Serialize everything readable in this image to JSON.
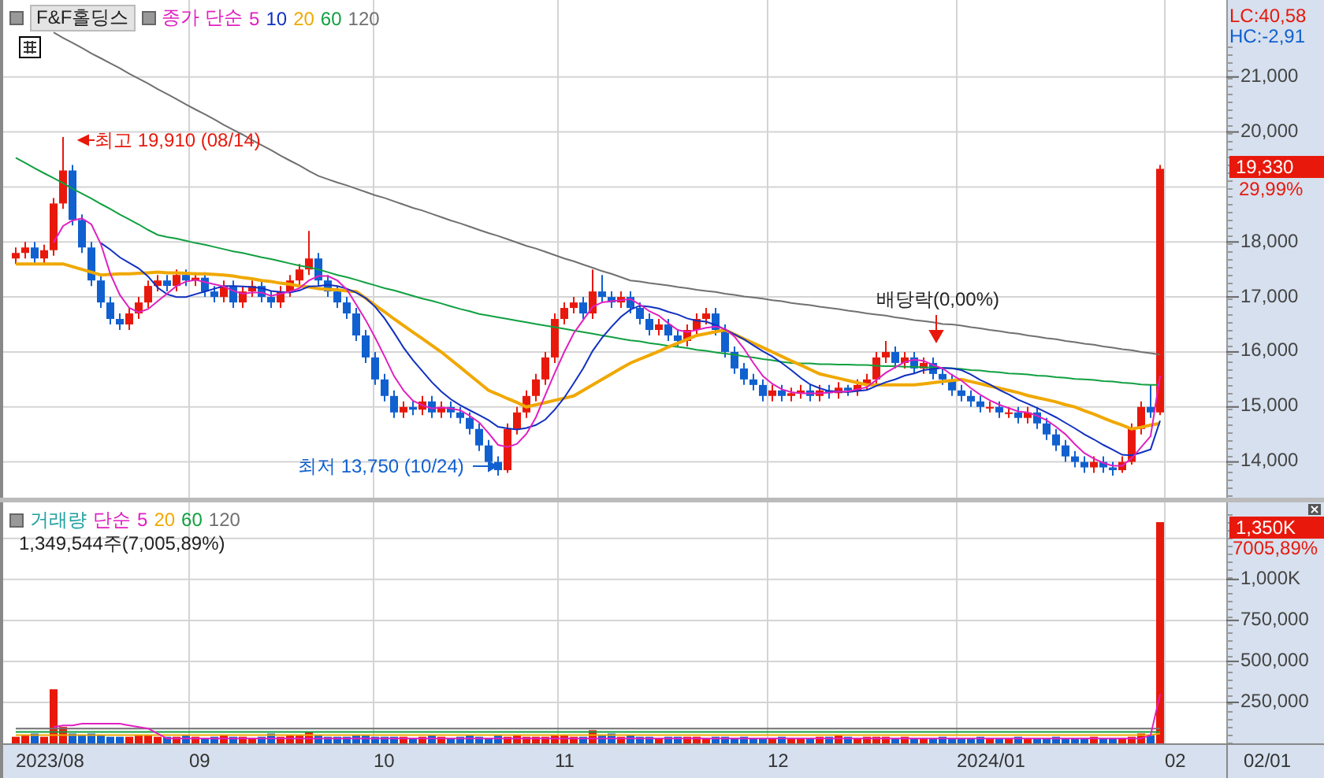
{
  "legend": {
    "ticker": "F&F홀딩스",
    "label": "종가 단순"
  },
  "price_chart": {
    "lc": "LC:40,58",
    "hc": "HC:-2,91",
    "current": "19,330",
    "change": "29,99%",
    "chart_data": {
      "type": "candlestick",
      "ylim": [
        13350,
        22400
      ],
      "grid": true,
      "series": [
        {
          "name": "5",
          "color": "#e020c0",
          "type": "line",
          "values": [
            null,
            null,
            null,
            null,
            17990,
            18290,
            18390,
            18430,
            18320,
            17960,
            17420,
            17040,
            16800,
            16720,
            16780,
            16920,
            17060,
            17200,
            17280,
            17310,
            17270,
            17230,
            17190,
            17110,
            17060,
            17080,
            17080,
            17020,
            17060,
            17100,
            17160,
            17300,
            17380,
            17380,
            17300,
            17140,
            16860,
            16580,
            16260,
            15920,
            15560,
            15300,
            15110,
            15030,
            14970,
            14990,
            14970,
            14940,
            14840,
            14720,
            14520,
            14310,
            14270,
            14330,
            14510,
            14810,
            15220,
            15620,
            16000,
            16340,
            16580,
            16820,
            16900,
            16920,
            16940,
            16960,
            16860,
            16740,
            16660,
            16520,
            16400,
            16360,
            16400,
            16440,
            16460,
            16420,
            16280,
            16060,
            15800,
            15560,
            15420,
            15320,
            15270,
            15250,
            15250,
            15250,
            15260,
            15280,
            15280,
            15320,
            15360,
            15490,
            15620,
            15720,
            15820,
            15860,
            15840,
            15760,
            15700,
            15580,
            15480,
            15340,
            15220,
            15120,
            15040,
            14980,
            14920,
            14900,
            14840,
            14760,
            14640,
            14500,
            14320,
            14160,
            14060,
            13980,
            13930,
            13930,
            14070,
            14270,
            14470,
            15570
          ]
        },
        {
          "name": "10",
          "color": "#1030c0",
          "type": "line",
          "values": [
            null,
            null,
            null,
            null,
            null,
            null,
            null,
            null,
            null,
            17980,
            17860,
            17720,
            17620,
            17520,
            17370,
            17170,
            17050,
            17000,
            17000,
            17050,
            17100,
            17150,
            17200,
            17200,
            17190,
            17180,
            17160,
            17110,
            17090,
            17080,
            17120,
            17190,
            17200,
            17220,
            17200,
            17150,
            17080,
            16980,
            16820,
            16610,
            16350,
            16080,
            15850,
            15650,
            15450,
            15280,
            15140,
            15030,
            14940,
            14850,
            14760,
            14640,
            14610,
            14590,
            14620,
            14670,
            14770,
            14950,
            15170,
            15430,
            15700,
            16020,
            16260,
            16460,
            16640,
            16770,
            16840,
            16820,
            16790,
            16730,
            16680,
            16610,
            16570,
            16550,
            16490,
            16410,
            16320,
            16230,
            16120,
            16010,
            15920,
            15800,
            15670,
            15530,
            15410,
            15340,
            15290,
            15280,
            15270,
            15290,
            15310,
            15380,
            15450,
            15500,
            15570,
            15610,
            15670,
            15690,
            15710,
            15700,
            15670,
            15590,
            15490,
            15410,
            15310,
            15230,
            15130,
            15060,
            14980,
            14900,
            14810,
            14710,
            14610,
            14500,
            14410,
            14310,
            14220,
            14130,
            14120,
            14170,
            14230,
            14750
          ]
        },
        {
          "name": "20",
          "color": "#f0a800",
          "type": "line",
          "values": [
            17600,
            17600,
            17600,
            17600,
            17600,
            17600,
            17550,
            17500,
            17450,
            17400,
            17410,
            17420,
            17420,
            17430,
            17440,
            17450,
            17440,
            17440,
            17430,
            17420,
            17420,
            17410,
            17400,
            17380,
            17350,
            17330,
            17300,
            17280,
            17250,
            17230,
            17200,
            17180,
            17150,
            17140,
            17130,
            17110,
            17100,
            16980,
            16850,
            16730,
            16600,
            16480,
            16360,
            16240,
            16120,
            16000,
            15860,
            15720,
            15580,
            15440,
            15300,
            15230,
            15150,
            15080,
            15000,
            15040,
            15080,
            15120,
            15160,
            15200,
            15300,
            15400,
            15500,
            15600,
            15700,
            15800,
            15870,
            15940,
            16010,
            16090,
            16160,
            16230,
            16300,
            16330,
            16370,
            16400,
            16320,
            16240,
            16160,
            16080,
            16000,
            15920,
            15840,
            15760,
            15680,
            15600,
            15560,
            15520,
            15480,
            15440,
            15400,
            15400,
            15400,
            15400,
            15400,
            15400,
            15420,
            15440,
            15460,
            15480,
            15500,
            15460,
            15420,
            15380,
            15340,
            15300,
            15260,
            15210,
            15170,
            15130,
            15090,
            15040,
            15000,
            14930,
            14870,
            14800,
            14730,
            14670,
            14600,
            14630,
            14670,
            14700
          ]
        },
        {
          "name": "60",
          "color": "#10a040",
          "type": "line",
          "values": [
            19530,
            19440,
            19340,
            19250,
            19160,
            19070,
            18970,
            18880,
            18790,
            18690,
            18600,
            18500,
            18410,
            18320,
            18220,
            18130,
            18090,
            18060,
            18020,
            17980,
            17950,
            17910,
            17870,
            17830,
            17800,
            17760,
            17720,
            17690,
            17650,
            17610,
            17570,
            17540,
            17500,
            17450,
            17400,
            17360,
            17310,
            17260,
            17210,
            17160,
            17120,
            17070,
            17020,
            16970,
            16930,
            16880,
            16830,
            16780,
            16740,
            16690,
            16660,
            16630,
            16600,
            16570,
            16540,
            16510,
            16480,
            16450,
            16420,
            16390,
            16360,
            16330,
            16300,
            16270,
            16240,
            16210,
            16190,
            16160,
            16140,
            16110,
            16090,
            16070,
            16040,
            16020,
            15990,
            15970,
            15950,
            15920,
            15900,
            15870,
            15850,
            15820,
            15800,
            15790,
            15790,
            15780,
            15780,
            15770,
            15770,
            15760,
            15760,
            15750,
            15740,
            15740,
            15730,
            15730,
            15720,
            15720,
            15710,
            15700,
            15690,
            15670,
            15660,
            15640,
            15630,
            15610,
            15600,
            15590,
            15570,
            15560,
            15540,
            15530,
            15510,
            15500,
            15490,
            15470,
            15460,
            15440,
            15430,
            15410,
            15400,
            15400
          ]
        },
        {
          "name": "120",
          "color": "#707070",
          "type": "line",
          "values": [
            null,
            null,
            null,
            null,
            21810,
            21710,
            21620,
            21530,
            21430,
            21340,
            21250,
            21160,
            21060,
            20970,
            20880,
            20780,
            20690,
            20600,
            20500,
            20410,
            20320,
            20230,
            20130,
            20040,
            19950,
            19850,
            19760,
            19670,
            19570,
            19480,
            19390,
            19290,
            19200,
            19140,
            19080,
            19030,
            18970,
            18910,
            18850,
            18800,
            18740,
            18680,
            18620,
            18570,
            18510,
            18450,
            18390,
            18340,
            18280,
            18220,
            18160,
            18110,
            18050,
            17990,
            17930,
            17880,
            17820,
            17760,
            17700,
            17650,
            17590,
            17530,
            17470,
            17420,
            17360,
            17300,
            17280,
            17250,
            17230,
            17210,
            17180,
            17160,
            17130,
            17110,
            17090,
            17060,
            17040,
            17010,
            16990,
            16970,
            16940,
            16920,
            16890,
            16870,
            16850,
            16820,
            16800,
            16780,
            16750,
            16730,
            16700,
            16680,
            16660,
            16630,
            16610,
            16580,
            16560,
            16540,
            16510,
            16500,
            16480,
            16450,
            16430,
            16400,
            16380,
            16350,
            16330,
            16300,
            16280,
            16250,
            16230,
            16200,
            16180,
            16150,
            16130,
            16100,
            16080,
            16050,
            16030,
            16000,
            15980,
            15950
          ]
        }
      ],
      "yticks": [
        {
          "value": 21000,
          "label": "21,000"
        },
        {
          "value": 20000,
          "label": "20,000"
        },
        {
          "value": 18000,
          "label": "18,000"
        },
        {
          "value": 17000,
          "label": "17,000"
        },
        {
          "value": 16000,
          "label": "16,000"
        },
        {
          "value": 15000,
          "label": "15,000"
        },
        {
          "value": 14000,
          "label": "14,000"
        }
      ],
      "ohlc": [
        [
          17700,
          17900,
          17600,
          17800
        ],
        [
          17800,
          18000,
          17700,
          17900
        ],
        [
          17900,
          18000,
          17600,
          17700
        ],
        [
          17700,
          17950,
          17600,
          17850
        ],
        [
          17850,
          18800,
          17750,
          18700
        ],
        [
          18700,
          19910,
          18600,
          19300
        ],
        [
          19300,
          19400,
          18300,
          18400
        ],
        [
          18400,
          18500,
          17800,
          17900
        ],
        [
          17900,
          18000,
          17200,
          17300
        ],
        [
          17300,
          17400,
          16800,
          16900
        ],
        [
          16900,
          17000,
          16500,
          16600
        ],
        [
          16600,
          16700,
          16400,
          16500
        ],
        [
          16500,
          16800,
          16400,
          16700
        ],
        [
          16700,
          17000,
          16600,
          16900
        ],
        [
          16900,
          17300,
          16800,
          17200
        ],
        [
          17200,
          17400,
          17100,
          17300
        ],
        [
          17300,
          17400,
          17100,
          17200
        ],
        [
          17200,
          17500,
          17100,
          17400
        ],
        [
          17400,
          17500,
          17200,
          17300
        ],
        [
          17300,
          17450,
          17200,
          17350
        ],
        [
          17350,
          17450,
          17000,
          17100
        ],
        [
          17100,
          17200,
          16900,
          17000
        ],
        [
          17000,
          17300,
          16900,
          17200
        ],
        [
          17200,
          17300,
          16800,
          16900
        ],
        [
          16900,
          17200,
          16800,
          17100
        ],
        [
          17100,
          17300,
          17000,
          17200
        ],
        [
          17200,
          17300,
          16900,
          17000
        ],
        [
          17000,
          17100,
          16800,
          16900
        ],
        [
          16900,
          17200,
          16800,
          17100
        ],
        [
          17100,
          17400,
          17000,
          17300
        ],
        [
          17300,
          17600,
          17200,
          17500
        ],
        [
          17500,
          18200,
          17400,
          17700
        ],
        [
          17700,
          17800,
          17200,
          17300
        ],
        [
          17300,
          17400,
          17000,
          17100
        ],
        [
          17100,
          17200,
          16800,
          16900
        ],
        [
          16900,
          17000,
          16600,
          16700
        ],
        [
          16700,
          16800,
          16200,
          16300
        ],
        [
          16300,
          16400,
          15800,
          15900
        ],
        [
          15900,
          16000,
          15400,
          15500
        ],
        [
          15500,
          15600,
          15100,
          15200
        ],
        [
          15200,
          15300,
          14800,
          14900
        ],
        [
          14900,
          15100,
          14800,
          15000
        ],
        [
          15000,
          15100,
          14850,
          14950
        ],
        [
          14950,
          15200,
          14850,
          15100
        ],
        [
          15100,
          15200,
          14800,
          14900
        ],
        [
          14900,
          15100,
          14800,
          15000
        ],
        [
          15000,
          15100,
          14800,
          14900
        ],
        [
          14900,
          15000,
          14700,
          14800
        ],
        [
          14800,
          14900,
          14500,
          14600
        ],
        [
          14600,
          14700,
          14200,
          14300
        ],
        [
          14300,
          14400,
          13900,
          14000
        ],
        [
          14000,
          14100,
          13750,
          13850
        ],
        [
          13850,
          14700,
          13800,
          14600
        ],
        [
          14600,
          15000,
          14500,
          14900
        ],
        [
          14900,
          15300,
          14800,
          15200
        ],
        [
          15200,
          15600,
          15100,
          15500
        ],
        [
          15500,
          16000,
          15400,
          15900
        ],
        [
          15900,
          16700,
          15800,
          16600
        ],
        [
          16600,
          16900,
          16500,
          16800
        ],
        [
          16800,
          17000,
          16700,
          16900
        ],
        [
          16900,
          17000,
          16600,
          16700
        ],
        [
          16700,
          17500,
          16600,
          17100
        ],
        [
          17100,
          17400,
          16900,
          17000
        ],
        [
          17000,
          17100,
          16800,
          16900
        ],
        [
          16900,
          17100,
          16800,
          17000
        ],
        [
          17000,
          17100,
          16700,
          16800
        ],
        [
          16800,
          16900,
          16500,
          16600
        ],
        [
          16600,
          16700,
          16300,
          16400
        ],
        [
          16400,
          16600,
          16300,
          16500
        ],
        [
          16500,
          16600,
          16200,
          16300
        ],
        [
          16300,
          16400,
          16100,
          16200
        ],
        [
          16200,
          16500,
          16100,
          16400
        ],
        [
          16400,
          16700,
          16300,
          16600
        ],
        [
          16600,
          16800,
          16500,
          16700
        ],
        [
          16700,
          16800,
          16300,
          16400
        ],
        [
          16400,
          16500,
          15900,
          16000
        ],
        [
          16000,
          16100,
          15600,
          15700
        ],
        [
          15700,
          15800,
          15400,
          15500
        ],
        [
          15500,
          15600,
          15300,
          15400
        ],
        [
          15400,
          15500,
          15100,
          15200
        ],
        [
          15200,
          15400,
          15100,
          15300
        ],
        [
          15300,
          15400,
          15100,
          15200
        ],
        [
          15200,
          15350,
          15100,
          15250
        ],
        [
          15250,
          15400,
          15150,
          15300
        ],
        [
          15300,
          15400,
          15100,
          15200
        ],
        [
          15200,
          15400,
          15100,
          15300
        ],
        [
          15300,
          15400,
          15150,
          15250
        ],
        [
          15250,
          15450,
          15150,
          15350
        ],
        [
          15350,
          15400,
          15200,
          15300
        ],
        [
          15300,
          15500,
          15200,
          15400
        ],
        [
          15400,
          15600,
          15300,
          15500
        ],
        [
          15500,
          16000,
          15400,
          15900
        ],
        [
          15900,
          16200,
          15800,
          16000
        ],
        [
          16000,
          16100,
          15700,
          15800
        ],
        [
          15800,
          16000,
          15700,
          15900
        ],
        [
          15900,
          16000,
          15600,
          15700
        ],
        [
          15700,
          15900,
          15600,
          15800
        ],
        [
          15800,
          15900,
          15500,
          15600
        ],
        [
          15600,
          15700,
          15400,
          15500
        ],
        [
          15500,
          15600,
          15200,
          15300
        ],
        [
          15300,
          15400,
          15100,
          15200
        ],
        [
          15200,
          15300,
          15000,
          15100
        ],
        [
          15100,
          15200,
          14900,
          15000
        ],
        [
          15000,
          15100,
          14900,
          15000
        ],
        [
          15000,
          15100,
          14800,
          14900
        ],
        [
          14900,
          15000,
          14800,
          14900
        ],
        [
          14900,
          15000,
          14700,
          14800
        ],
        [
          14800,
          15000,
          14700,
          14900
        ],
        [
          14900,
          15000,
          14600,
          14700
        ],
        [
          14700,
          14800,
          14400,
          14500
        ],
        [
          14500,
          14600,
          14200,
          14300
        ],
        [
          14300,
          14400,
          14000,
          14100
        ],
        [
          14100,
          14200,
          13900,
          14000
        ],
        [
          14000,
          14100,
          13800,
          13900
        ],
        [
          13900,
          14100,
          13800,
          14000
        ],
        [
          14000,
          14100,
          13800,
          13900
        ],
        [
          13900,
          14000,
          13750,
          13850
        ],
        [
          13850,
          14100,
          13800,
          14000
        ],
        [
          14000,
          14700,
          13950,
          14600
        ],
        [
          14600,
          15100,
          14500,
          15000
        ],
        [
          15000,
          15400,
          14800,
          14900
        ],
        [
          14900,
          19400,
          14850,
          19330
        ]
      ]
    }
  },
  "annotations": {
    "high": "최고 19,910 (08/14)",
    "low": "최저 13,750 (10/24)",
    "dividend": "배당락(0,00%)"
  },
  "volume": {
    "label": "거래량",
    "sub": "단순",
    "reading": "1,349,544주(7,005,89%)",
    "current": "1,350K",
    "change": "7005,89%",
    "chart_data": {
      "type": "bar",
      "ylim": [
        0,
        1470000
      ],
      "grid": true,
      "series": [
        {
          "name": "5",
          "color": "#e020c0",
          "type": "line",
          "values": [
            null,
            null,
            null,
            null,
            100000,
            110000,
            110000,
            120000,
            120000,
            120000,
            120000,
            120000,
            110000,
            100000,
            90000,
            60000,
            30000,
            30000,
            30000,
            30000,
            30000,
            30000,
            30000,
            30000,
            30000,
            30000,
            30000,
            30000,
            30000,
            30000,
            30000,
            30000,
            30000,
            30000,
            30000,
            30000,
            30000,
            30000,
            30000,
            30000,
            30000,
            30000,
            30000,
            30000,
            30000,
            30000,
            30000,
            30000,
            30000,
            30000,
            30000,
            30000,
            30000,
            30000,
            30000,
            30000,
            30000,
            30000,
            30000,
            30000,
            30000,
            30000,
            30000,
            30000,
            30000,
            30000,
            30000,
            30000,
            30000,
            30000,
            30000,
            30000,
            30000,
            30000,
            30000,
            30000,
            30000,
            30000,
            30000,
            30000,
            30000,
            30000,
            30000,
            30000,
            30000,
            30000,
            30000,
            30000,
            30000,
            30000,
            30000,
            30000,
            30000,
            30000,
            30000,
            30000,
            30000,
            30000,
            30000,
            30000,
            30000,
            30000,
            30000,
            30000,
            30000,
            30000,
            30000,
            30000,
            30000,
            30000,
            30000,
            30000,
            30000,
            30000,
            30000,
            30000,
            30000,
            30000,
            30000,
            30000,
            50000,
            300000
          ]
        },
        {
          "name": "20",
          "color": "#f0a800",
          "type": "line",
          "values": [
            50000,
            50000,
            50000,
            50000,
            50000,
            50000,
            50000,
            50000,
            50000,
            50000,
            50000,
            50000,
            50000,
            50000,
            50000,
            50000,
            50000,
            50000,
            50000,
            50000,
            50000,
            50000,
            50000,
            50000,
            50000,
            50000,
            50000,
            50000,
            50000,
            50000,
            50000,
            50000,
            50000,
            50000,
            50000,
            50000,
            50000,
            50000,
            50000,
            50000,
            50000,
            50000,
            50000,
            50000,
            50000,
            50000,
            50000,
            50000,
            50000,
            50000,
            50000,
            50000,
            50000,
            50000,
            50000,
            50000,
            50000,
            50000,
            50000,
            50000,
            50000,
            50000,
            50000,
            50000,
            50000,
            50000,
            50000,
            50000,
            50000,
            50000,
            50000,
            50000,
            50000,
            50000,
            50000,
            50000,
            50000,
            50000,
            50000,
            50000,
            50000,
            50000,
            50000,
            50000,
            50000,
            50000,
            50000,
            50000,
            50000,
            50000,
            50000,
            50000,
            50000,
            50000,
            50000,
            50000,
            50000,
            50000,
            50000,
            50000,
            50000,
            50000,
            50000,
            50000,
            50000,
            50000,
            50000,
            50000,
            50000,
            50000,
            50000,
            50000,
            50000,
            50000,
            50000,
            50000,
            50000,
            50000,
            50000,
            50000,
            50000,
            60000
          ]
        },
        {
          "name": "60",
          "color": "#10a040",
          "type": "line",
          "values": [
            70000,
            70000,
            70000,
            70000,
            70000,
            70000,
            70000,
            70000,
            70000,
            70000,
            70000,
            70000,
            70000,
            70000,
            70000,
            70000,
            70000,
            70000,
            70000,
            70000,
            70000,
            70000,
            70000,
            70000,
            70000,
            70000,
            70000,
            70000,
            70000,
            70000,
            70000,
            70000,
            70000,
            70000,
            70000,
            70000,
            70000,
            70000,
            70000,
            70000,
            70000,
            70000,
            70000,
            70000,
            70000,
            70000,
            70000,
            70000,
            70000,
            70000,
            70000,
            70000,
            70000,
            70000,
            70000,
            70000,
            70000,
            70000,
            70000,
            70000,
            70000,
            70000,
            70000,
            70000,
            70000,
            70000,
            70000,
            70000,
            70000,
            70000,
            70000,
            70000,
            70000,
            70000,
            70000,
            70000,
            70000,
            70000,
            70000,
            70000,
            70000,
            70000,
            70000,
            70000,
            70000,
            70000,
            70000,
            70000,
            70000,
            70000,
            70000,
            70000,
            70000,
            70000,
            70000,
            70000,
            70000,
            70000,
            70000,
            70000,
            70000,
            70000,
            70000,
            70000,
            70000,
            70000,
            70000,
            70000,
            70000,
            70000,
            70000,
            70000,
            70000,
            70000,
            70000,
            70000,
            70000,
            70000,
            70000,
            70000,
            70000,
            70000
          ]
        },
        {
          "name": "120",
          "color": "#707070",
          "type": "line",
          "values": [
            90000,
            90000,
            90000,
            90000,
            90000,
            90000,
            90000,
            90000,
            90000,
            90000,
            90000,
            90000,
            90000,
            90000,
            90000,
            90000,
            90000,
            90000,
            90000,
            90000,
            90000,
            90000,
            90000,
            90000,
            90000,
            90000,
            90000,
            90000,
            90000,
            90000,
            90000,
            90000,
            90000,
            90000,
            90000,
            90000,
            90000,
            90000,
            90000,
            90000,
            90000,
            90000,
            90000,
            90000,
            90000,
            90000,
            90000,
            90000,
            90000,
            90000,
            90000,
            90000,
            90000,
            90000,
            90000,
            90000,
            90000,
            90000,
            90000,
            90000,
            90000,
            90000,
            90000,
            90000,
            90000,
            90000,
            90000,
            90000,
            90000,
            90000,
            90000,
            90000,
            90000,
            90000,
            90000,
            90000,
            90000,
            90000,
            90000,
            90000,
            90000,
            90000,
            90000,
            90000,
            90000,
            90000,
            90000,
            90000,
            90000,
            90000,
            90000,
            90000,
            90000,
            90000,
            90000,
            90000,
            90000,
            90000,
            90000,
            90000,
            90000,
            90000,
            90000,
            90000,
            90000,
            90000,
            90000,
            90000,
            90000,
            90000,
            90000,
            90000,
            90000,
            90000,
            90000,
            90000,
            90000,
            90000,
            90000,
            90000,
            90000,
            90000
          ]
        }
      ],
      "yticks": [
        {
          "value": 1000000,
          "label": "1,000K"
        },
        {
          "value": 750000,
          "label": "750,000"
        },
        {
          "value": 500000,
          "label": "500,000"
        },
        {
          "value": 250000,
          "label": "250,000"
        }
      ],
      "values": [
        40000,
        50000,
        60000,
        40000,
        330000,
        100000,
        60000,
        50000,
        60000,
        50000,
        40000,
        40000,
        40000,
        50000,
        50000,
        40000,
        40000,
        40000,
        50000,
        40000,
        30000,
        40000,
        50000,
        40000,
        40000,
        30000,
        40000,
        60000,
        40000,
        50000,
        50000,
        70000,
        50000,
        40000,
        40000,
        40000,
        50000,
        50000,
        40000,
        40000,
        40000,
        40000,
        30000,
        40000,
        50000,
        40000,
        30000,
        40000,
        50000,
        40000,
        30000,
        50000,
        40000,
        50000,
        40000,
        40000,
        40000,
        50000,
        50000,
        40000,
        40000,
        80000,
        50000,
        60000,
        40000,
        50000,
        40000,
        40000,
        30000,
        40000,
        40000,
        40000,
        40000,
        30000,
        40000,
        40000,
        30000,
        40000,
        30000,
        30000,
        30000,
        40000,
        30000,
        30000,
        30000,
        40000,
        40000,
        50000,
        40000,
        30000,
        40000,
        40000,
        40000,
        30000,
        40000,
        30000,
        30000,
        30000,
        40000,
        30000,
        30000,
        30000,
        40000,
        30000,
        30000,
        30000,
        40000,
        30000,
        30000,
        30000,
        40000,
        30000,
        30000,
        30000,
        40000,
        30000,
        30000,
        30000,
        40000,
        60000,
        50000,
        1349544
      ],
      "colors": [
        "#e8190c",
        "#e8190c",
        "#1060d0",
        "#e8190c",
        "#e8190c",
        "#e8190c",
        "#1060d0",
        "#1060d0",
        "#1060d0",
        "#1060d0",
        "#1060d0",
        "#1060d0",
        "#e8190c",
        "#e8190c",
        "#e8190c",
        "#e8190c",
        "#1060d0",
        "#e8190c",
        "#1060d0",
        "#e8190c",
        "#1060d0",
        "#1060d0",
        "#e8190c",
        "#1060d0",
        "#e8190c",
        "#e8190c",
        "#1060d0",
        "#1060d0",
        "#e8190c",
        "#e8190c",
        "#e8190c",
        "#e8190c",
        "#1060d0",
        "#1060d0",
        "#1060d0",
        "#1060d0",
        "#1060d0",
        "#1060d0",
        "#1060d0",
        "#1060d0",
        "#1060d0",
        "#e8190c",
        "#1060d0",
        "#e8190c",
        "#1060d0",
        "#e8190c",
        "#1060d0",
        "#1060d0",
        "#1060d0",
        "#1060d0",
        "#1060d0",
        "#1060d0",
        "#e8190c",
        "#e8190c",
        "#e8190c",
        "#e8190c",
        "#e8190c",
        "#e8190c",
        "#e8190c",
        "#e8190c",
        "#1060d0",
        "#e8190c",
        "#1060d0",
        "#1060d0",
        "#e8190c",
        "#1060d0",
        "#1060d0",
        "#1060d0",
        "#e8190c",
        "#1060d0",
        "#1060d0",
        "#e8190c",
        "#e8190c",
        "#e8190c",
        "#1060d0",
        "#1060d0",
        "#1060d0",
        "#1060d0",
        "#1060d0",
        "#1060d0",
        "#e8190c",
        "#1060d0",
        "#e8190c",
        "#e8190c",
        "#1060d0",
        "#e8190c",
        "#1060d0",
        "#e8190c",
        "#1060d0",
        "#e8190c",
        "#e8190c",
        "#e8190c",
        "#e8190c",
        "#1060d0",
        "#e8190c",
        "#1060d0",
        "#e8190c",
        "#1060d0",
        "#1060d0",
        "#1060d0",
        "#1060d0",
        "#1060d0",
        "#1060d0",
        "#e8190c",
        "#1060d0",
        "#e8190c",
        "#1060d0",
        "#e8190c",
        "#1060d0",
        "#1060d0",
        "#1060d0",
        "#1060d0",
        "#1060d0",
        "#1060d0",
        "#e8190c",
        "#1060d0",
        "#1060d0",
        "#e8190c",
        "#e8190c",
        "#e8190c",
        "#1060d0",
        "#e8190c"
      ]
    }
  },
  "x_axis": {
    "labels": [
      "2023/08",
      "09",
      "10",
      "11",
      "12",
      "2024/01",
      "02"
    ],
    "cursor_date": "02/01"
  }
}
